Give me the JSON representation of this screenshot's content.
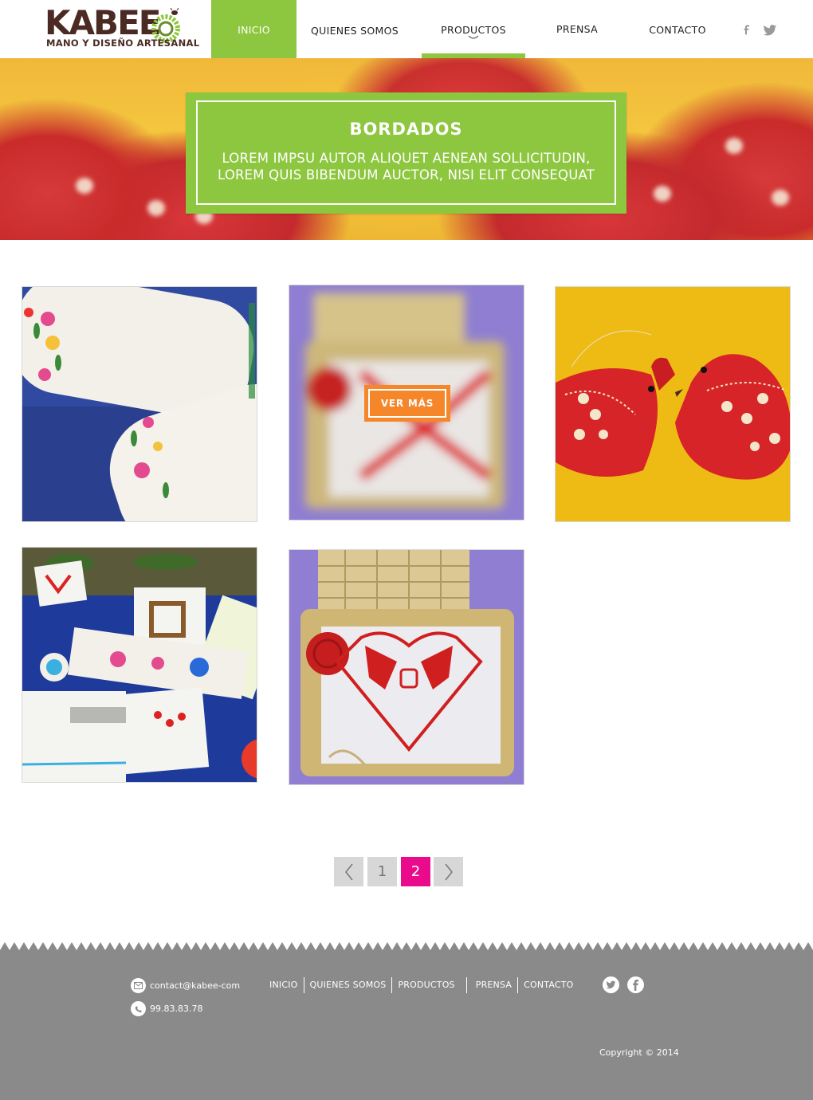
{
  "brand": {
    "name": "KABEE",
    "tagline": "MANO Y DISEÑO ARTESANAL",
    "color_green": "#8dc63f",
    "color_brown": "#4a2a22"
  },
  "nav": {
    "items": [
      {
        "label": "INICIO",
        "state": "highlighted"
      },
      {
        "label": "QUIENES SOMOS"
      },
      {
        "label": "PRODUCTOS",
        "state": "current"
      },
      {
        "label": "PRENSA"
      },
      {
        "label": "CONTACTO"
      }
    ],
    "social": [
      "facebook-icon",
      "twitter-icon"
    ]
  },
  "hero": {
    "title": "BORDADOS",
    "text_line1": "LOREM IMPSU AUTOR ALIQUET AENEAN SOLLICITUDIN,",
    "text_line2": "LOREM QUIS BIBENDUM AUCTOR, NISI ELIT CONSEQUAT"
  },
  "gallery": {
    "tiles": [
      {
        "subject": "embroidered-pillows"
      },
      {
        "subject": "basket-cross-stitch",
        "hover_button": "VER MÁS"
      },
      {
        "subject": "red-fabric-birds"
      },
      {
        "subject": "embroidered-napkins"
      },
      {
        "subject": "basket-cross-stitch"
      }
    ],
    "button_color": "#f5872a"
  },
  "pagination": {
    "prev": "‹",
    "pages": [
      "1",
      "2"
    ],
    "current": "2",
    "next": "›",
    "active_color": "#ea0b8c"
  },
  "footer": {
    "email": "contact@kabee-com",
    "phone": "99.83.83.78",
    "links": [
      "INICIO",
      "QUIENES SOMOS",
      "PRODUCTOS",
      "PRENSA",
      "CONTACTO"
    ],
    "social": [
      "twitter-icon",
      "facebook-icon"
    ],
    "copyright": "Copyright © 2014",
    "background": "#8a8a8a"
  }
}
